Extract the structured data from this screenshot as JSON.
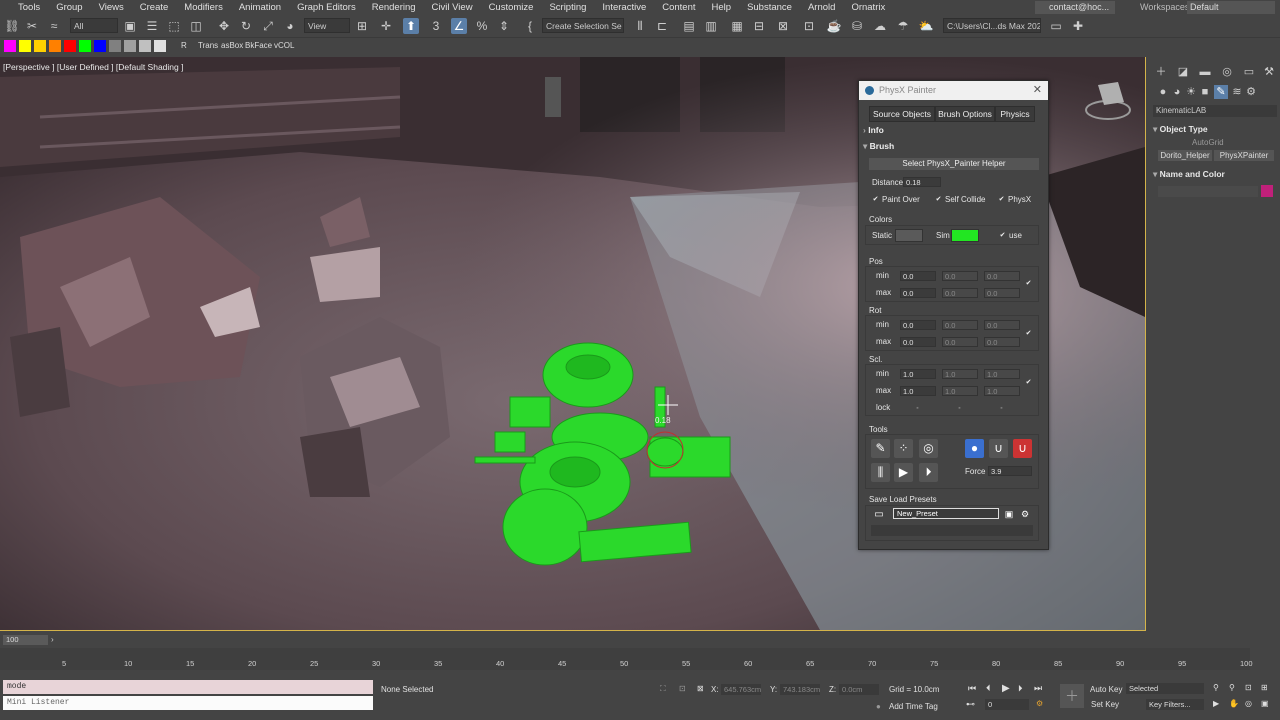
{
  "menus": [
    "Tools",
    "Group",
    "Views",
    "Create",
    "Modifiers",
    "Animation",
    "Graph Editors",
    "Rendering",
    "Civil View",
    "Customize",
    "Scripting",
    "Interactive",
    "Content",
    "Help",
    "Substance",
    "Arnold",
    "Ornatrix"
  ],
  "account": "contact@hoc...",
  "workspace": {
    "label": "Workspaces:",
    "value": "Default"
  },
  "toolbar": {
    "filter_all": "All",
    "ref_coord": "View",
    "named_selection": "Create Selection Se",
    "path": "C:\\Users\\Cl...ds Max 202"
  },
  "quick_buttons": [
    "R",
    "Trans",
    "asBox",
    "BkFace",
    "vCOL"
  ],
  "swatches": [
    "#ff00ff",
    "#ffff00",
    "#ffd000",
    "#ff8000",
    "#ff0000",
    "#00ff00",
    "#0000ff",
    "#808080",
    "#a0a0a0",
    "#c0c0c0",
    "#e0e0e0"
  ],
  "viewport": {
    "label": "[Perspective ] [User Defined ] [Default Shading ]",
    "brush_value": "0.18"
  },
  "command_panel": {
    "dropdown": "KinematicLAB",
    "object_type": {
      "title": "Object Type",
      "autogrid": "AutoGrid",
      "buttons": [
        "Dorito_Helper",
        "PhysXPainter"
      ]
    },
    "name_color": {
      "title": "Name and Color",
      "color": "#c0207a"
    }
  },
  "physx": {
    "title": "PhysX Painter",
    "tabs": [
      "Source Objects",
      "Brush Options",
      "Physics"
    ],
    "info": "Info",
    "brush": "Brush",
    "select_helper": "Select PhysX_Painter Helper",
    "distance_label": "Distance",
    "distance": "0.18",
    "checks": [
      {
        "label": "Paint Over",
        "checked": true
      },
      {
        "label": "Self Collide",
        "checked": true
      },
      {
        "label": "PhysX",
        "checked": true
      }
    ],
    "colors": {
      "title": "Colors",
      "static_label": "Static",
      "static_color": "#5a5a5a",
      "sim_label": "Sim",
      "sim_color": "#22e622",
      "use_label": "use",
      "use_checked": true
    },
    "pos": {
      "title": "Pos",
      "min_label": "min",
      "max_label": "max",
      "min": [
        "0.0",
        "0.0",
        "0.0"
      ],
      "max": [
        "0.0",
        "0.0",
        "0.0"
      ]
    },
    "rot": {
      "title": "Rot",
      "min_label": "min",
      "max_label": "max",
      "min": [
        "0.0",
        "0.0",
        "0.0"
      ],
      "max": [
        "0.0",
        "0.0",
        "0.0"
      ]
    },
    "scl": {
      "title": "Scl.",
      "min_label": "min",
      "max_label": "max",
      "lock_label": "lock",
      "min": [
        "1.0",
        "1.0",
        "1.0"
      ],
      "max": [
        "1.0",
        "1.0",
        "1.0"
      ]
    },
    "tools": {
      "title": "Tools",
      "force_label": "Force",
      "force": "3.9"
    },
    "presets": {
      "title": "Save Load Presets",
      "name": "New_Preset"
    }
  },
  "timeline": {
    "frame": "100",
    "ticks": [
      "5",
      "10",
      "15",
      "20",
      "25",
      "30",
      "35",
      "40",
      "45",
      "50",
      "55",
      "60",
      "65",
      "70",
      "75",
      "80",
      "85",
      "90",
      "95",
      "100"
    ]
  },
  "status": {
    "maxscript_input": "mode",
    "maxscript_output": "Mini Listener",
    "selection": "None Selected",
    "x_label": "X:",
    "x": "645.763cm",
    "y_label": "Y:",
    "y": "743.183cm",
    "z_label": "Z:",
    "z": "0.0cm",
    "grid": "Grid = 10.0cm",
    "add_time_tag": "Add Time Tag",
    "auto_key": "Auto Key",
    "set_key": "Set Key",
    "key_mode": "Selected",
    "key_filters": "Key Filters...",
    "current_frame": "0"
  }
}
